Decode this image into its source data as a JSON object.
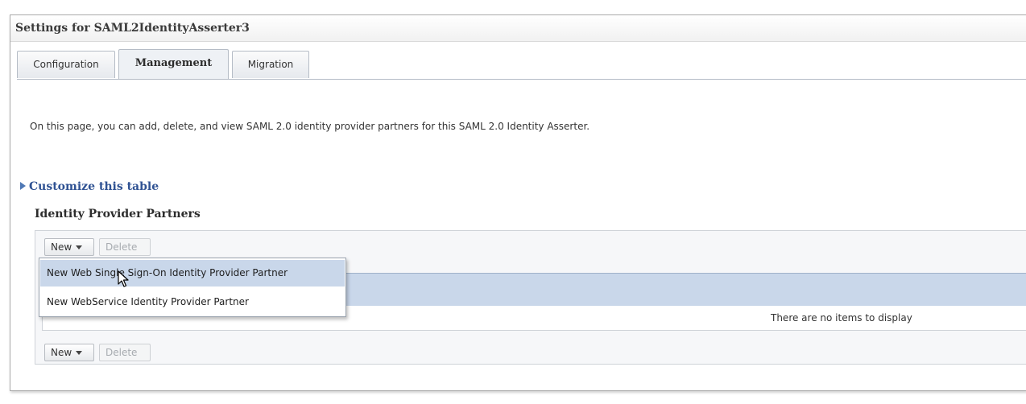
{
  "window": {
    "title": "Settings for SAML2IdentityAsserter3"
  },
  "tabs": [
    {
      "label": "Configuration",
      "active": false
    },
    {
      "label": "Management",
      "active": true
    },
    {
      "label": "Migration",
      "active": false
    }
  ],
  "main": {
    "intro": "On this page, you can add, delete, and view SAML 2.0 identity provider partners for this SAML 2.0 Identity Asserter.",
    "customize_label": "Customize this table",
    "section_title": "Identity Provider Partners",
    "toolbar": {
      "new_label": "New",
      "delete_label": "Delete"
    },
    "table": {
      "empty_message": "There are no items to display"
    }
  },
  "new_menu": {
    "items": [
      {
        "label": "New Web Single Sign-On Identity Provider Partner",
        "hovered": true
      },
      {
        "label": "New WebService Identity Provider Partner",
        "hovered": false
      }
    ]
  },
  "colors": {
    "accent": "#2f5293",
    "selection": "#c9d7ea"
  }
}
